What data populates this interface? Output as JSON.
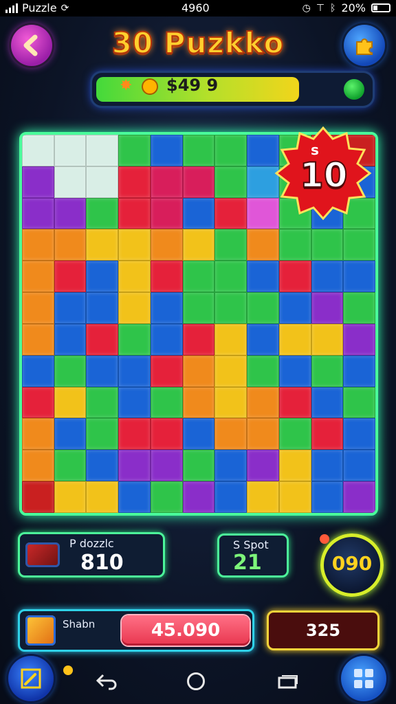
{
  "status_bar": {
    "app_name": "Puzzle",
    "carrier": "4960",
    "battery": "20%"
  },
  "header": {
    "title": "30 Puzkko",
    "score": "$49 9"
  },
  "board": {
    "timer_badge_label": "s",
    "timer_badge_value": "10",
    "rows": [
      [
        "#d9eee6",
        "#d9eee6",
        "#d9eee6",
        "#2fc44a",
        "#1a64d6",
        "#2fc44a",
        "#2fc44a",
        "#1a64d6",
        "#2fc44a",
        "#c92020",
        "#c92020"
      ],
      [
        "#8a2ec9",
        "#d9eee6",
        "#d9eee6",
        "#e5213a",
        "#d81e5b",
        "#d81e5b",
        "#2fc44a",
        "#2d9fe0",
        "#2fc44a",
        "#c92020",
        "#1a64d6"
      ],
      [
        "#8a2ec9",
        "#8a2ec9",
        "#2fc44a",
        "#e5213a",
        "#d81e5b",
        "#1a64d6",
        "#e5213a",
        "#e056d8",
        "#2fc44a",
        "#1a64d6",
        "#2fc44a"
      ],
      [
        "#f08a1c",
        "#f08a1c",
        "#f2c21a",
        "#f2c21a",
        "#f08a1c",
        "#f2c21a",
        "#2fc44a",
        "#f08a1c",
        "#2fc44a",
        "#2fc44a",
        "#2fc44a"
      ],
      [
        "#f08a1c",
        "#e5213a",
        "#1a64d6",
        "#f2c21a",
        "#e5213a",
        "#2fc44a",
        "#2fc44a",
        "#1a64d6",
        "#e5213a",
        "#1a64d6",
        "#1a64d6"
      ],
      [
        "#f08a1c",
        "#1a64d6",
        "#1a64d6",
        "#f2c21a",
        "#1a64d6",
        "#2fc44a",
        "#2fc44a",
        "#2fc44a",
        "#1a64d6",
        "#8a2ec9",
        "#2fc44a"
      ],
      [
        "#f08a1c",
        "#1a64d6",
        "#e5213a",
        "#2fc44a",
        "#1a64d6",
        "#e5213a",
        "#f2c21a",
        "#1a64d6",
        "#f2c21a",
        "#f2c21a",
        "#8a2ec9"
      ],
      [
        "#1a64d6",
        "#2fc44a",
        "#1a64d6",
        "#1a64d6",
        "#e5213a",
        "#f08a1c",
        "#f2c21a",
        "#2fc44a",
        "#1a64d6",
        "#2fc44a",
        "#1a64d6"
      ],
      [
        "#e5213a",
        "#f2c21a",
        "#2fc44a",
        "#1a64d6",
        "#2fc44a",
        "#f08a1c",
        "#f2c21a",
        "#f08a1c",
        "#e5213a",
        "#1a64d6",
        "#2fc44a"
      ],
      [
        "#f08a1c",
        "#1a64d6",
        "#2fc44a",
        "#e5213a",
        "#e5213a",
        "#1a64d6",
        "#f08a1c",
        "#f08a1c",
        "#2fc44a",
        "#e5213a",
        "#1a64d6"
      ],
      [
        "#f08a1c",
        "#2fc44a",
        "#1a64d6",
        "#8a2ec9",
        "#8a2ec9",
        "#2fc44a",
        "#1a64d6",
        "#8a2ec9",
        "#f2c21a",
        "#1a64d6",
        "#1a64d6"
      ],
      [
        "#c92020",
        "#f2c21a",
        "#f2c21a",
        "#1a64d6",
        "#2fc44a",
        "#8a2ec9",
        "#1a64d6",
        "#f2c21a",
        "#f2c21a",
        "#1a64d6",
        "#8a2ec9"
      ]
    ]
  },
  "stats": {
    "pieces_label": "P dozzlc",
    "pieces_value": "810",
    "spot_label": "S Spot",
    "spot_value": "21",
    "timer_value": "090"
  },
  "bottom": {
    "ship_label": "Shabn",
    "red_button_value": "45.090",
    "coins_value": "325"
  },
  "colors": {
    "board_glow": "#4aff9b",
    "title_fill": "#ffcf2e",
    "badge_red": "#e0141c"
  }
}
